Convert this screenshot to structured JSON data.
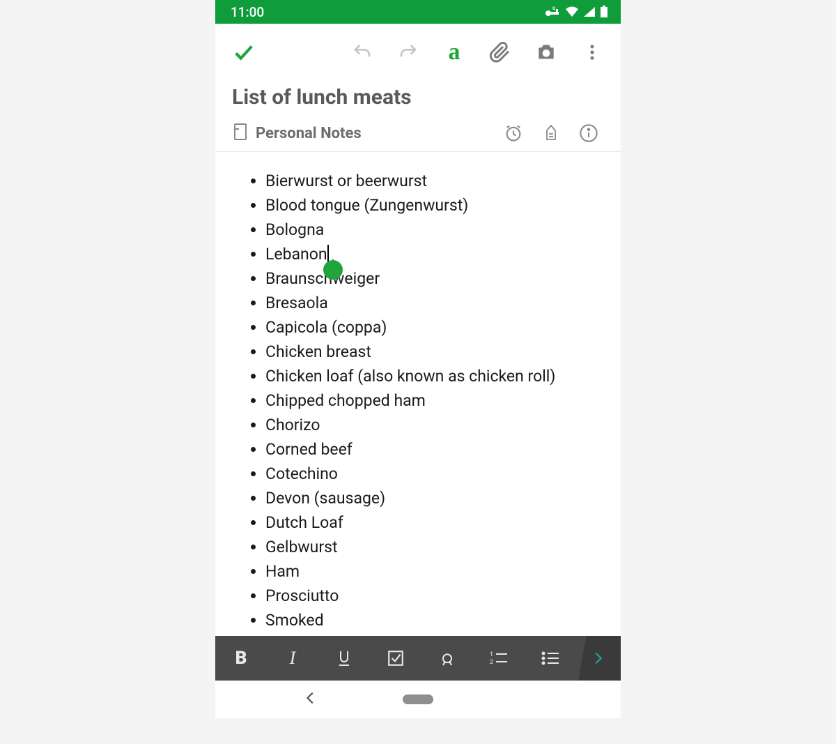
{
  "statusbar": {
    "time": "11:00"
  },
  "note": {
    "title": "List of lunch meats",
    "notebook": "Personal Notes",
    "items": [
      "Bierwurst or beerwurst",
      "Blood tongue (Zungenwurst)",
      "Bologna",
      "Lebanon",
      "Braunschweiger",
      "Bresaola",
      "Capicola (coppa)",
      "Chicken breast",
      "Chicken loaf (also known as chicken roll)",
      "Chipped chopped ham",
      "Chorizo",
      "Corned beef",
      "Cotechino",
      "Devon (sausage)",
      "Dutch Loaf",
      "Gelbwurst",
      "Ham",
      "Prosciutto",
      "Smoked"
    ],
    "cursor_after_index": 3
  },
  "format": {
    "bold": "B",
    "italic": "I",
    "textstyle": "a"
  }
}
